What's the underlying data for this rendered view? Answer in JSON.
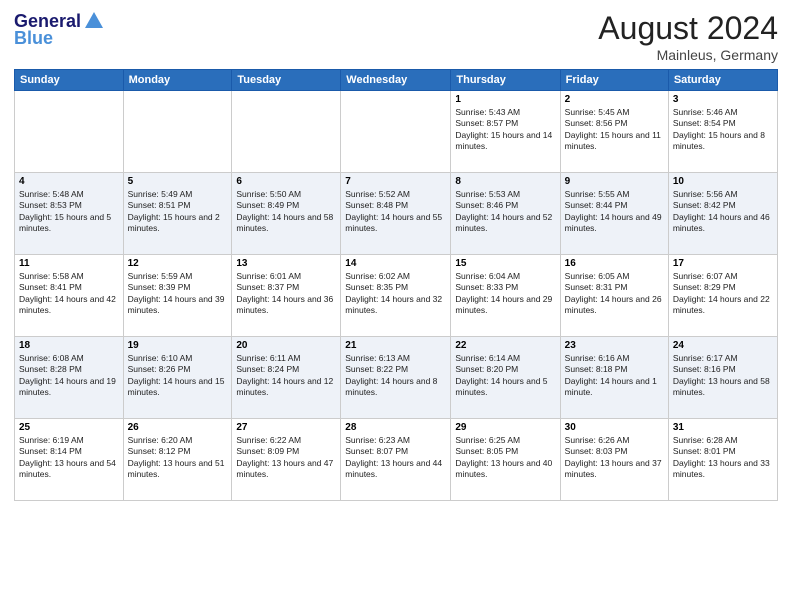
{
  "header": {
    "logo_general": "General",
    "logo_blue": "Blue",
    "month_title": "August 2024",
    "location": "Mainleus, Germany"
  },
  "days": [
    "Sunday",
    "Monday",
    "Tuesday",
    "Wednesday",
    "Thursday",
    "Friday",
    "Saturday"
  ],
  "weeks": [
    [
      {
        "date": "",
        "info": ""
      },
      {
        "date": "",
        "info": ""
      },
      {
        "date": "",
        "info": ""
      },
      {
        "date": "",
        "info": ""
      },
      {
        "date": "1",
        "info": "Sunrise: 5:43 AM\nSunset: 8:57 PM\nDaylight: 15 hours and 14 minutes."
      },
      {
        "date": "2",
        "info": "Sunrise: 5:45 AM\nSunset: 8:56 PM\nDaylight: 15 hours and 11 minutes."
      },
      {
        "date": "3",
        "info": "Sunrise: 5:46 AM\nSunset: 8:54 PM\nDaylight: 15 hours and 8 minutes."
      }
    ],
    [
      {
        "date": "4",
        "info": "Sunrise: 5:48 AM\nSunset: 8:53 PM\nDaylight: 15 hours and 5 minutes."
      },
      {
        "date": "5",
        "info": "Sunrise: 5:49 AM\nSunset: 8:51 PM\nDaylight: 15 hours and 2 minutes."
      },
      {
        "date": "6",
        "info": "Sunrise: 5:50 AM\nSunset: 8:49 PM\nDaylight: 14 hours and 58 minutes."
      },
      {
        "date": "7",
        "info": "Sunrise: 5:52 AM\nSunset: 8:48 PM\nDaylight: 14 hours and 55 minutes."
      },
      {
        "date": "8",
        "info": "Sunrise: 5:53 AM\nSunset: 8:46 PM\nDaylight: 14 hours and 52 minutes."
      },
      {
        "date": "9",
        "info": "Sunrise: 5:55 AM\nSunset: 8:44 PM\nDaylight: 14 hours and 49 minutes."
      },
      {
        "date": "10",
        "info": "Sunrise: 5:56 AM\nSunset: 8:42 PM\nDaylight: 14 hours and 46 minutes."
      }
    ],
    [
      {
        "date": "11",
        "info": "Sunrise: 5:58 AM\nSunset: 8:41 PM\nDaylight: 14 hours and 42 minutes."
      },
      {
        "date": "12",
        "info": "Sunrise: 5:59 AM\nSunset: 8:39 PM\nDaylight: 14 hours and 39 minutes."
      },
      {
        "date": "13",
        "info": "Sunrise: 6:01 AM\nSunset: 8:37 PM\nDaylight: 14 hours and 36 minutes."
      },
      {
        "date": "14",
        "info": "Sunrise: 6:02 AM\nSunset: 8:35 PM\nDaylight: 14 hours and 32 minutes."
      },
      {
        "date": "15",
        "info": "Sunrise: 6:04 AM\nSunset: 8:33 PM\nDaylight: 14 hours and 29 minutes."
      },
      {
        "date": "16",
        "info": "Sunrise: 6:05 AM\nSunset: 8:31 PM\nDaylight: 14 hours and 26 minutes."
      },
      {
        "date": "17",
        "info": "Sunrise: 6:07 AM\nSunset: 8:29 PM\nDaylight: 14 hours and 22 minutes."
      }
    ],
    [
      {
        "date": "18",
        "info": "Sunrise: 6:08 AM\nSunset: 8:28 PM\nDaylight: 14 hours and 19 minutes."
      },
      {
        "date": "19",
        "info": "Sunrise: 6:10 AM\nSunset: 8:26 PM\nDaylight: 14 hours and 15 minutes."
      },
      {
        "date": "20",
        "info": "Sunrise: 6:11 AM\nSunset: 8:24 PM\nDaylight: 14 hours and 12 minutes."
      },
      {
        "date": "21",
        "info": "Sunrise: 6:13 AM\nSunset: 8:22 PM\nDaylight: 14 hours and 8 minutes."
      },
      {
        "date": "22",
        "info": "Sunrise: 6:14 AM\nSunset: 8:20 PM\nDaylight: 14 hours and 5 minutes."
      },
      {
        "date": "23",
        "info": "Sunrise: 6:16 AM\nSunset: 8:18 PM\nDaylight: 14 hours and 1 minute."
      },
      {
        "date": "24",
        "info": "Sunrise: 6:17 AM\nSunset: 8:16 PM\nDaylight: 13 hours and 58 minutes."
      }
    ],
    [
      {
        "date": "25",
        "info": "Sunrise: 6:19 AM\nSunset: 8:14 PM\nDaylight: 13 hours and 54 minutes."
      },
      {
        "date": "26",
        "info": "Sunrise: 6:20 AM\nSunset: 8:12 PM\nDaylight: 13 hours and 51 minutes."
      },
      {
        "date": "27",
        "info": "Sunrise: 6:22 AM\nSunset: 8:09 PM\nDaylight: 13 hours and 47 minutes."
      },
      {
        "date": "28",
        "info": "Sunrise: 6:23 AM\nSunset: 8:07 PM\nDaylight: 13 hours and 44 minutes."
      },
      {
        "date": "29",
        "info": "Sunrise: 6:25 AM\nSunset: 8:05 PM\nDaylight: 13 hours and 40 minutes."
      },
      {
        "date": "30",
        "info": "Sunrise: 6:26 AM\nSunset: 8:03 PM\nDaylight: 13 hours and 37 minutes."
      },
      {
        "date": "31",
        "info": "Sunrise: 6:28 AM\nSunset: 8:01 PM\nDaylight: 13 hours and 33 minutes."
      }
    ]
  ]
}
